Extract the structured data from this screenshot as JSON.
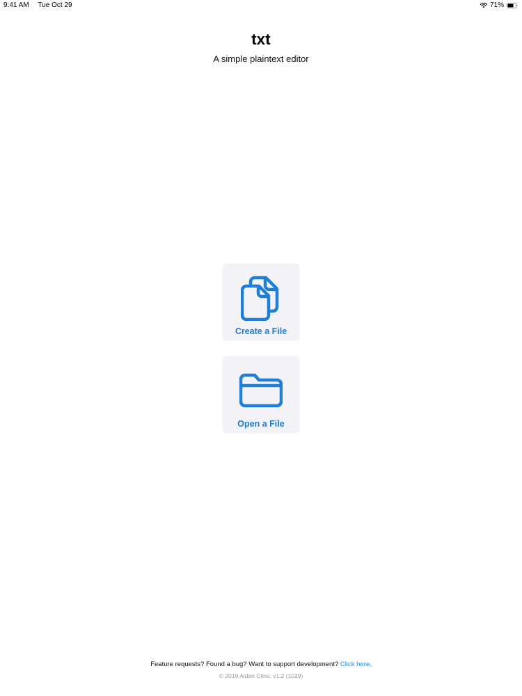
{
  "status_bar": {
    "time": "9:41 AM",
    "date": "Tue Oct 29",
    "battery": "71%"
  },
  "header": {
    "title": "txt",
    "subtitle": "A simple plaintext editor"
  },
  "actions": {
    "create_label": "Create a File",
    "open_label": "Open a File",
    "create_icon": "documents-icon",
    "open_icon": "folder-icon"
  },
  "footer": {
    "prompt": "Feature requests? Found a bug? Want to support development?",
    "link_text": "Click here.",
    "copyright": "© 2019 Aidan Cline, v1.2 (1029)"
  },
  "colors": {
    "accent": "#1f7fd6",
    "link": "#1a8ce0",
    "tile_background": "#f2f2f7"
  }
}
